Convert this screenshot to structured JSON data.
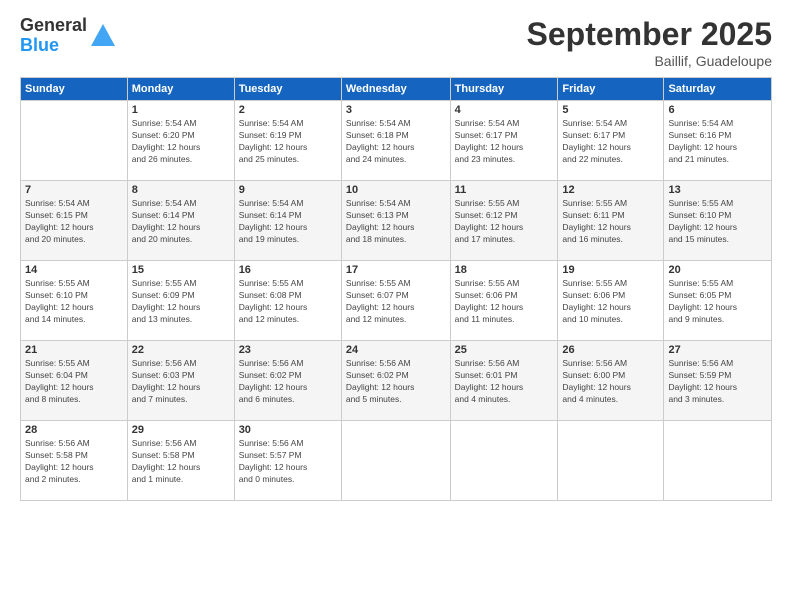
{
  "logo": {
    "general": "General",
    "blue": "Blue"
  },
  "title": "September 2025",
  "location": "Baillif, Guadeloupe",
  "days_of_week": [
    "Sunday",
    "Monday",
    "Tuesday",
    "Wednesday",
    "Thursday",
    "Friday",
    "Saturday"
  ],
  "weeks": [
    [
      {
        "day": "",
        "info": ""
      },
      {
        "day": "1",
        "info": "Sunrise: 5:54 AM\nSunset: 6:20 PM\nDaylight: 12 hours\nand 26 minutes."
      },
      {
        "day": "2",
        "info": "Sunrise: 5:54 AM\nSunset: 6:19 PM\nDaylight: 12 hours\nand 25 minutes."
      },
      {
        "day": "3",
        "info": "Sunrise: 5:54 AM\nSunset: 6:18 PM\nDaylight: 12 hours\nand 24 minutes."
      },
      {
        "day": "4",
        "info": "Sunrise: 5:54 AM\nSunset: 6:17 PM\nDaylight: 12 hours\nand 23 minutes."
      },
      {
        "day": "5",
        "info": "Sunrise: 5:54 AM\nSunset: 6:17 PM\nDaylight: 12 hours\nand 22 minutes."
      },
      {
        "day": "6",
        "info": "Sunrise: 5:54 AM\nSunset: 6:16 PM\nDaylight: 12 hours\nand 21 minutes."
      }
    ],
    [
      {
        "day": "7",
        "info": "Sunrise: 5:54 AM\nSunset: 6:15 PM\nDaylight: 12 hours\nand 20 minutes."
      },
      {
        "day": "8",
        "info": "Sunrise: 5:54 AM\nSunset: 6:14 PM\nDaylight: 12 hours\nand 20 minutes."
      },
      {
        "day": "9",
        "info": "Sunrise: 5:54 AM\nSunset: 6:14 PM\nDaylight: 12 hours\nand 19 minutes."
      },
      {
        "day": "10",
        "info": "Sunrise: 5:54 AM\nSunset: 6:13 PM\nDaylight: 12 hours\nand 18 minutes."
      },
      {
        "day": "11",
        "info": "Sunrise: 5:55 AM\nSunset: 6:12 PM\nDaylight: 12 hours\nand 17 minutes."
      },
      {
        "day": "12",
        "info": "Sunrise: 5:55 AM\nSunset: 6:11 PM\nDaylight: 12 hours\nand 16 minutes."
      },
      {
        "day": "13",
        "info": "Sunrise: 5:55 AM\nSunset: 6:10 PM\nDaylight: 12 hours\nand 15 minutes."
      }
    ],
    [
      {
        "day": "14",
        "info": "Sunrise: 5:55 AM\nSunset: 6:10 PM\nDaylight: 12 hours\nand 14 minutes."
      },
      {
        "day": "15",
        "info": "Sunrise: 5:55 AM\nSunset: 6:09 PM\nDaylight: 12 hours\nand 13 minutes."
      },
      {
        "day": "16",
        "info": "Sunrise: 5:55 AM\nSunset: 6:08 PM\nDaylight: 12 hours\nand 12 minutes."
      },
      {
        "day": "17",
        "info": "Sunrise: 5:55 AM\nSunset: 6:07 PM\nDaylight: 12 hours\nand 12 minutes."
      },
      {
        "day": "18",
        "info": "Sunrise: 5:55 AM\nSunset: 6:06 PM\nDaylight: 12 hours\nand 11 minutes."
      },
      {
        "day": "19",
        "info": "Sunrise: 5:55 AM\nSunset: 6:06 PM\nDaylight: 12 hours\nand 10 minutes."
      },
      {
        "day": "20",
        "info": "Sunrise: 5:55 AM\nSunset: 6:05 PM\nDaylight: 12 hours\nand 9 minutes."
      }
    ],
    [
      {
        "day": "21",
        "info": "Sunrise: 5:55 AM\nSunset: 6:04 PM\nDaylight: 12 hours\nand 8 minutes."
      },
      {
        "day": "22",
        "info": "Sunrise: 5:56 AM\nSunset: 6:03 PM\nDaylight: 12 hours\nand 7 minutes."
      },
      {
        "day": "23",
        "info": "Sunrise: 5:56 AM\nSunset: 6:02 PM\nDaylight: 12 hours\nand 6 minutes."
      },
      {
        "day": "24",
        "info": "Sunrise: 5:56 AM\nSunset: 6:02 PM\nDaylight: 12 hours\nand 5 minutes."
      },
      {
        "day": "25",
        "info": "Sunrise: 5:56 AM\nSunset: 6:01 PM\nDaylight: 12 hours\nand 4 minutes."
      },
      {
        "day": "26",
        "info": "Sunrise: 5:56 AM\nSunset: 6:00 PM\nDaylight: 12 hours\nand 4 minutes."
      },
      {
        "day": "27",
        "info": "Sunrise: 5:56 AM\nSunset: 5:59 PM\nDaylight: 12 hours\nand 3 minutes."
      }
    ],
    [
      {
        "day": "28",
        "info": "Sunrise: 5:56 AM\nSunset: 5:58 PM\nDaylight: 12 hours\nand 2 minutes."
      },
      {
        "day": "29",
        "info": "Sunrise: 5:56 AM\nSunset: 5:58 PM\nDaylight: 12 hours\nand 1 minute."
      },
      {
        "day": "30",
        "info": "Sunrise: 5:56 AM\nSunset: 5:57 PM\nDaylight: 12 hours\nand 0 minutes."
      },
      {
        "day": "",
        "info": ""
      },
      {
        "day": "",
        "info": ""
      },
      {
        "day": "",
        "info": ""
      },
      {
        "day": "",
        "info": ""
      }
    ]
  ]
}
